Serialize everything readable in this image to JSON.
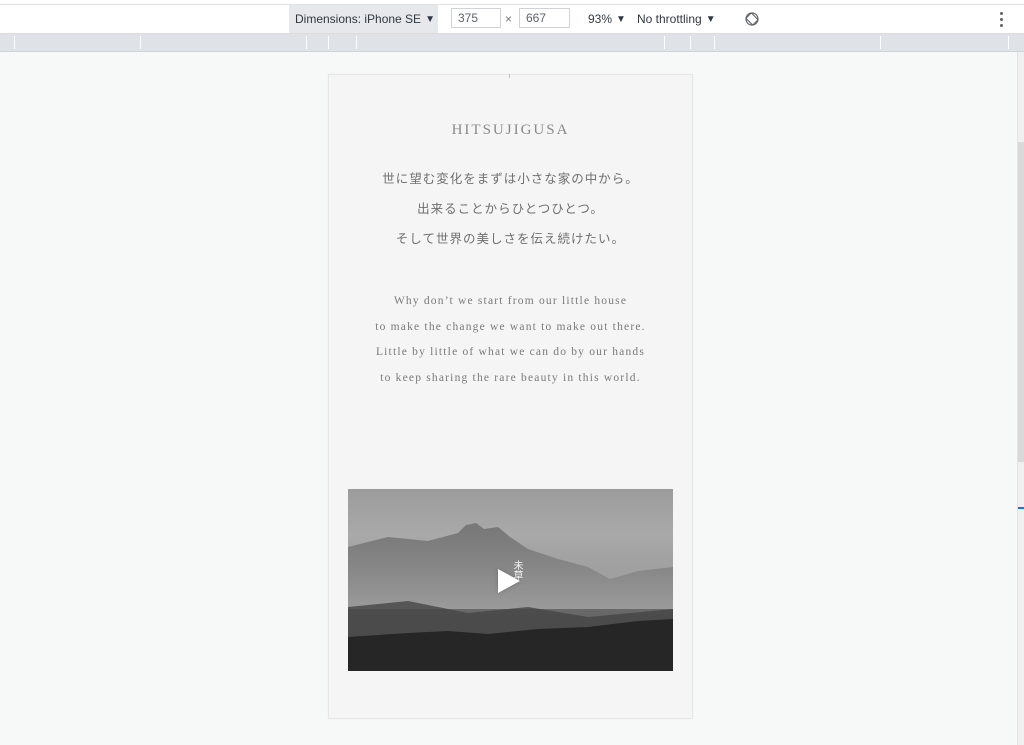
{
  "devtools": {
    "dimensions_label": "Dimensions: iPhone SE",
    "width": "375",
    "times": "×",
    "height": "667",
    "zoom": "93%",
    "throttling": "No throttling",
    "caret": "▼",
    "rotate_icon": "rotate-icon",
    "more_icon": "more-vert-icon"
  },
  "site": {
    "brand": "HITSUJIGUSA",
    "jp_lines": [
      "世に望む変化をまずは小さな家の中から。",
      "出来ることからひとつひとつ。",
      "そして世界の美しさを伝え続けたい。"
    ],
    "en_lines": [
      "Why don’t we start from our little house",
      "to make the change we want to make out there.",
      "Little by little of what we can do by our hands",
      "to keep sharing the rare beauty in this world."
    ],
    "video": {
      "overlay_title": "未草",
      "play_icon": "play-icon"
    }
  }
}
